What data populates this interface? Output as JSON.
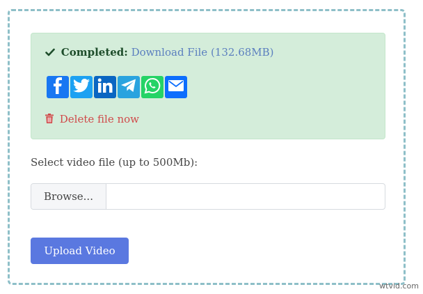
{
  "alert": {
    "completed_label": "Completed:",
    "download_text": "Download File (132.68MB)",
    "delete_text": "Delete file now",
    "share_buttons": [
      {
        "name": "facebook",
        "icon": "facebook-icon",
        "color": "#1877f2"
      },
      {
        "name": "twitter",
        "icon": "twitter-icon",
        "color": "#1da1f2"
      },
      {
        "name": "linkedin",
        "icon": "linkedin-icon",
        "color": "#0a66c2"
      },
      {
        "name": "telegram",
        "icon": "telegram-icon",
        "color": "#2aa3df"
      },
      {
        "name": "whatsapp",
        "icon": "whatsapp-icon",
        "color": "#25d366"
      },
      {
        "name": "email",
        "icon": "email-icon",
        "color": "#0d6efd"
      }
    ]
  },
  "upload": {
    "select_label": "Select video file (up to 500Mb):",
    "browse_label": "Browse...",
    "button_label": "Upload Video"
  },
  "watermark": "wtvid.com",
  "colors": {
    "alert_bg": "#d4edda",
    "link": "#5b7fbf",
    "delete": "#d04a4a",
    "primary": "#5a78e0",
    "dashed_border": "#8ebfc8"
  }
}
